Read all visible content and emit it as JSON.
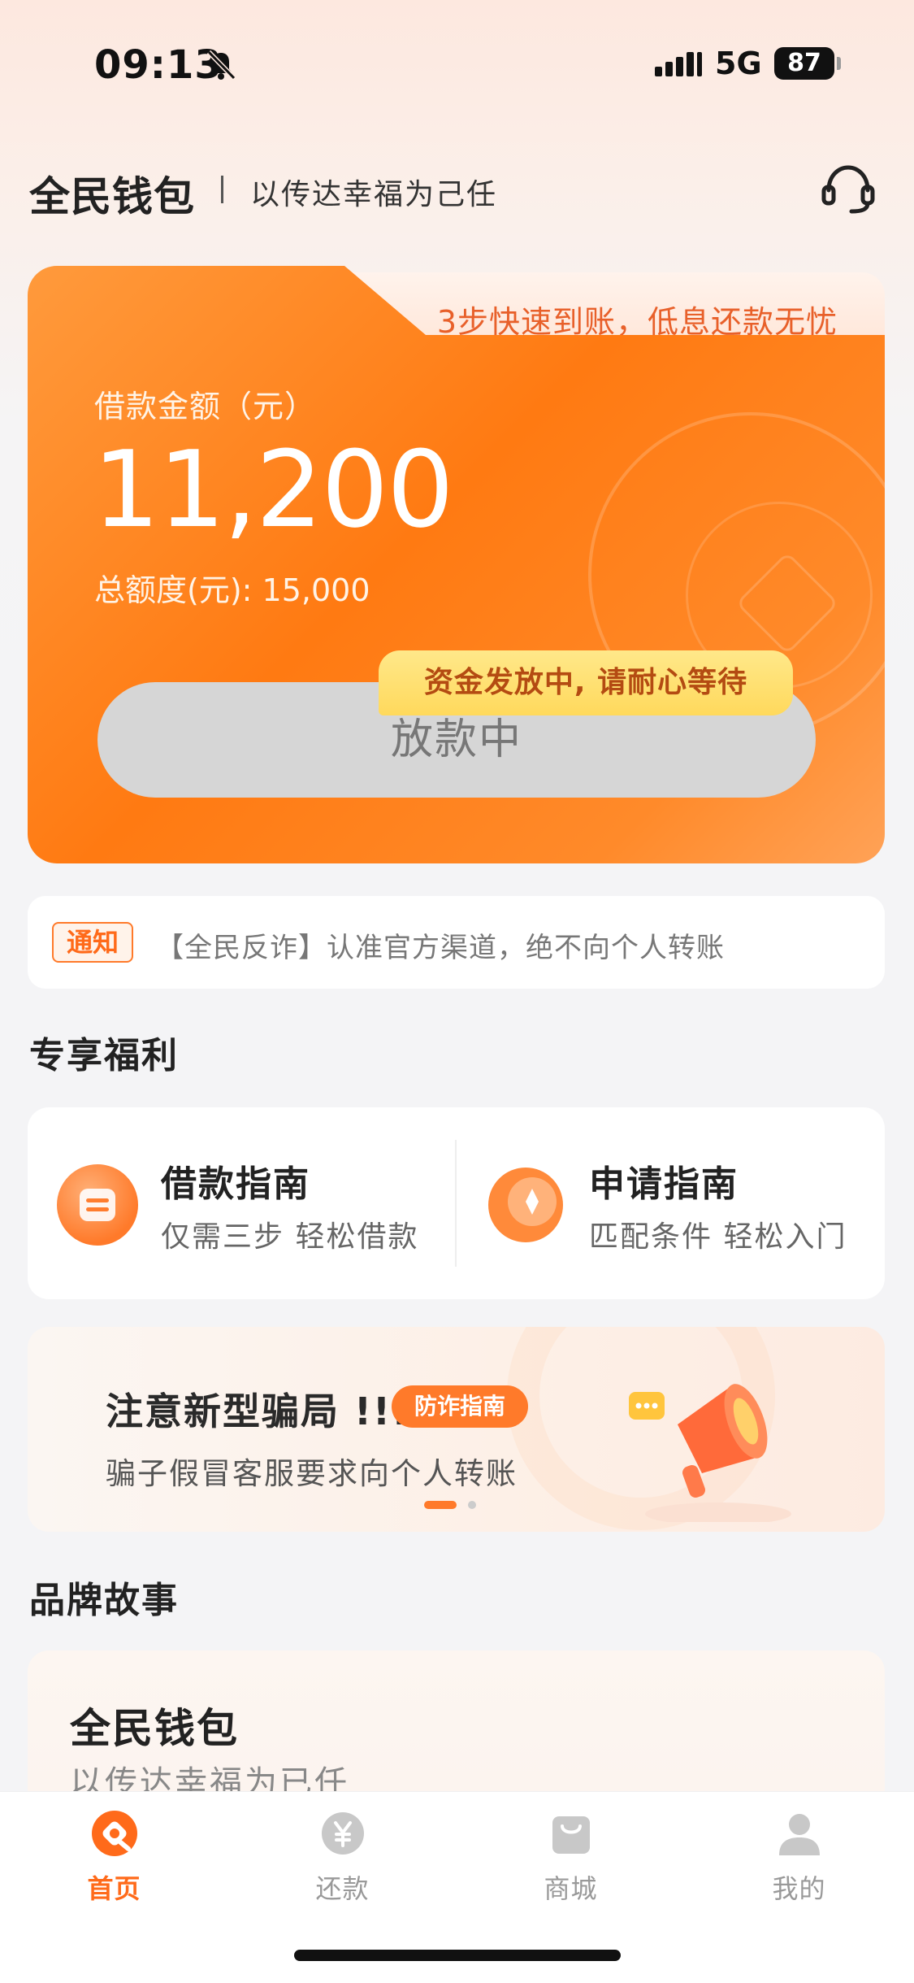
{
  "status_bar": {
    "time": "09:13",
    "network": "5G",
    "battery": "87"
  },
  "header": {
    "brand": "全民钱包",
    "slogan": "以传达幸福为己任"
  },
  "loan_card": {
    "tab_text": "3步快速到账，低息还款无忧",
    "amount_label": "借款金额（元）",
    "amount": "11,200",
    "total": "总额度(元): 15,000",
    "button_label": "放款中",
    "tip": "资金发放中, 请耐心等待"
  },
  "notice": {
    "tag": "通知",
    "text": "【全民反诈】认准官方渠道，绝不向个人转账"
  },
  "benefits": {
    "section_title": "专享福利",
    "items": [
      {
        "title": "借款指南",
        "subtitle": "仅需三步 轻松借款"
      },
      {
        "title": "申请指南",
        "subtitle": "匹配条件 轻松入门"
      }
    ]
  },
  "banner": {
    "title": "注意新型骗局 !!!",
    "tag": "防诈指南",
    "subtitle": "骗子假冒客服要求向个人转账"
  },
  "brand_story": {
    "section_title": "品牌故事",
    "title": "全民钱包",
    "subtitle": "以传达幸福为已任"
  },
  "tabbar": {
    "items": [
      {
        "label": "首页",
        "icon": "home-icon",
        "active": true
      },
      {
        "label": "还款",
        "icon": "repay-icon",
        "active": false
      },
      {
        "label": "商城",
        "icon": "mall-icon",
        "active": false
      },
      {
        "label": "我的",
        "icon": "profile-icon",
        "active": false
      }
    ]
  },
  "colors": {
    "accent": "#ff7a1a",
    "tip_bg": "#ffd95c",
    "button_disabled": "#d6d6d6"
  }
}
